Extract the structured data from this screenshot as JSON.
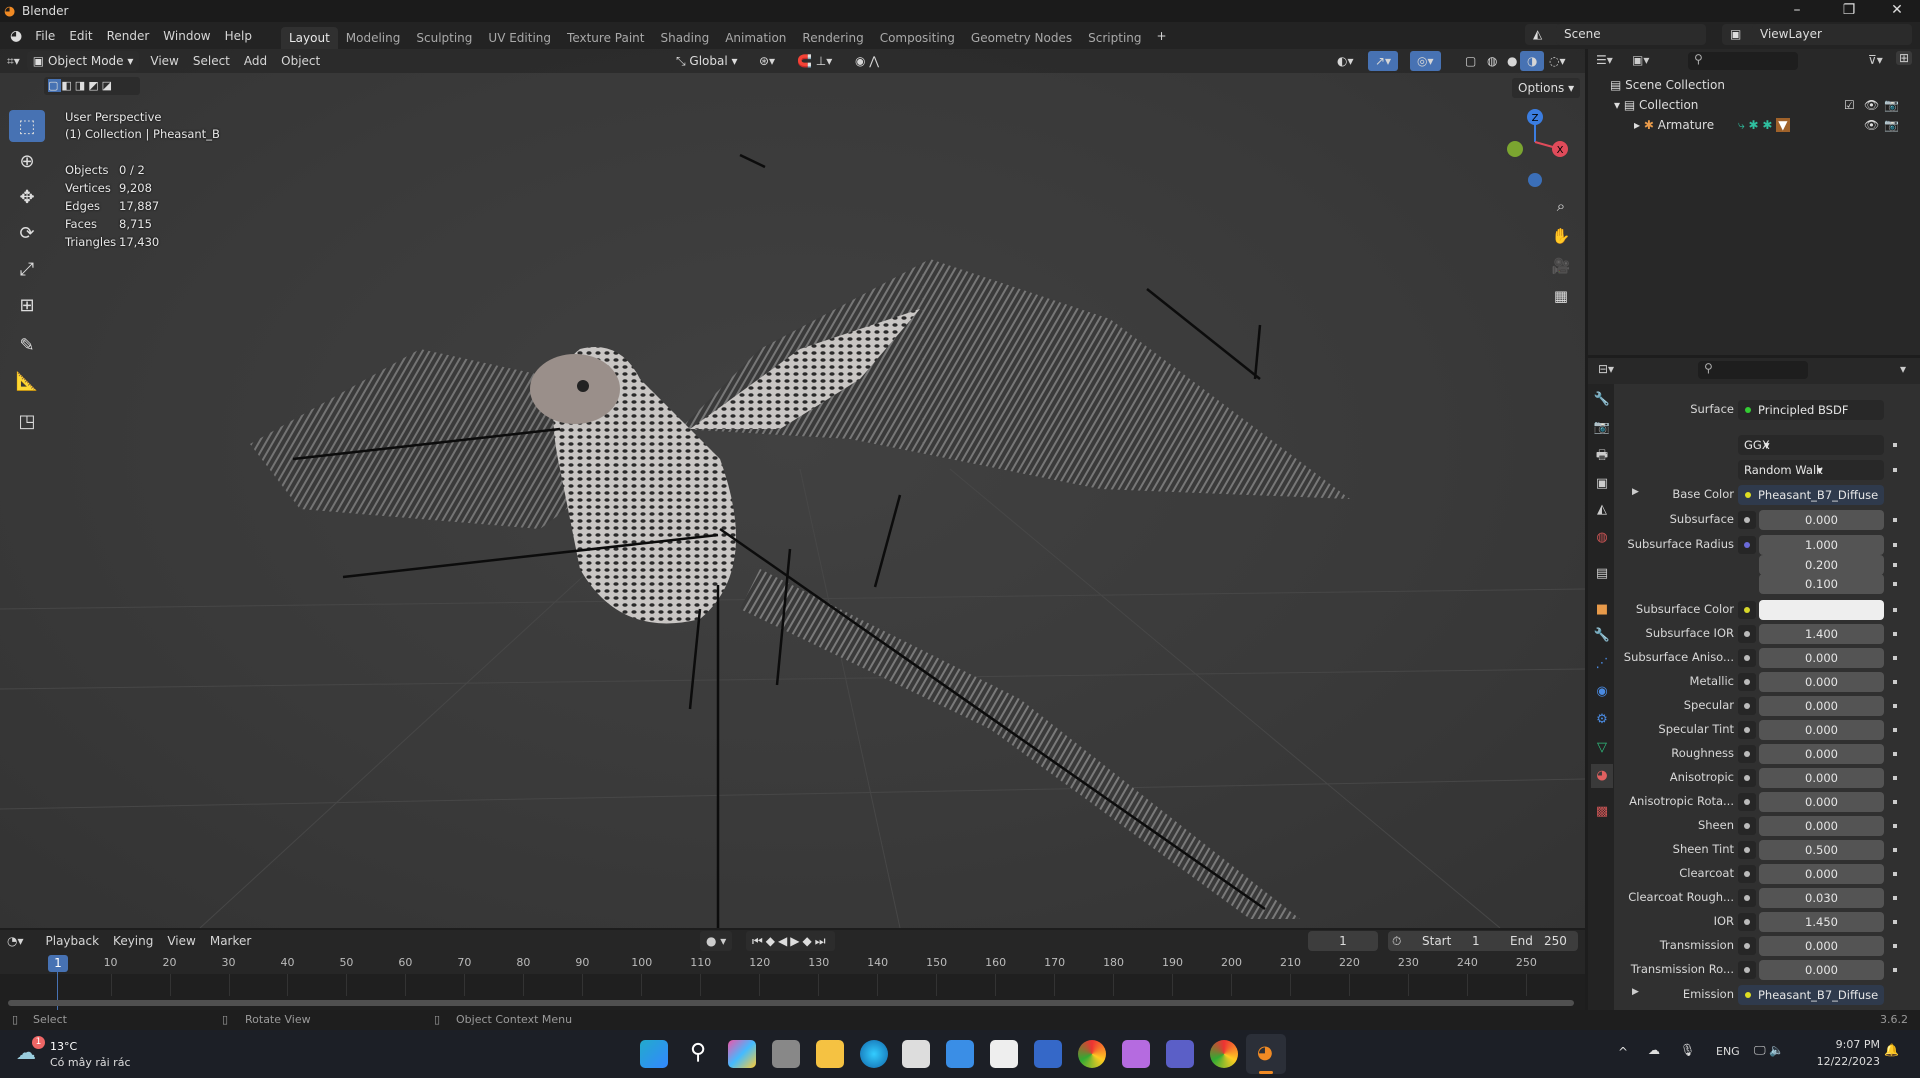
{
  "app": {
    "title": "Blender",
    "version": "3.6.2"
  },
  "menu": [
    "File",
    "Edit",
    "Render",
    "Window",
    "Help"
  ],
  "workspaces": [
    {
      "label": "Layout",
      "active": true
    },
    {
      "label": "Modeling"
    },
    {
      "label": "Sculpting"
    },
    {
      "label": "UV Editing"
    },
    {
      "label": "Texture Paint"
    },
    {
      "label": "Shading"
    },
    {
      "label": "Animation"
    },
    {
      "label": "Rendering"
    },
    {
      "label": "Compositing"
    },
    {
      "label": "Geometry Nodes"
    },
    {
      "label": "Scripting"
    }
  ],
  "add_workspace": "+",
  "scene": {
    "name": "Scene",
    "view_layer": "ViewLayer"
  },
  "viewport": {
    "mode": "Object Mode",
    "menus": [
      "View",
      "Select",
      "Add",
      "Object"
    ],
    "orientation": "Global",
    "options": "Options",
    "overlay_title": "User Perspective",
    "overlay_sub": "(1) Collection | Pheasant_B",
    "stats": [
      {
        "k": "Objects",
        "v": "0 / 2"
      },
      {
        "k": "Vertices",
        "v": "9,208"
      },
      {
        "k": "Edges",
        "v": "17,887"
      },
      {
        "k": "Faces",
        "v": "8,715"
      },
      {
        "k": "Triangles",
        "v": "17,430"
      }
    ],
    "gizmo": {
      "z": "Z",
      "x": "X"
    }
  },
  "outliner": {
    "items": [
      {
        "label": "Scene Collection"
      },
      {
        "label": "Collection"
      },
      {
        "label": "Armature"
      }
    ]
  },
  "properties": {
    "surface_label": "Surface",
    "surface_value": "Principled BSDF",
    "distribution": "GGX",
    "subsurface_method": "Random Walk",
    "base_color_label": "Base Color",
    "base_color_value": "Pheasant_B7_Diffuse",
    "rows": [
      {
        "label": "Subsurface",
        "value": "0.000",
        "fill": 0
      },
      {
        "label": "Subsurface Radius",
        "value": "1.000",
        "fill": 0,
        "sock": "#6a6ad8"
      },
      {
        "label": "",
        "value": "0.200",
        "fill": 0,
        "nosock": true
      },
      {
        "label": "",
        "value": "0.100",
        "fill": 0,
        "nosock": true
      },
      {
        "label": "Subsurface Color",
        "value": "",
        "fill": 0,
        "sock": "#d8d82a",
        "white": true
      },
      {
        "label": "Subsurface IOR",
        "value": "1.400",
        "fill": 0.1
      },
      {
        "label": "Subsurface Aniso...",
        "value": "0.000",
        "fill": 0
      },
      {
        "label": "Metallic",
        "value": "0.000",
        "fill": 0
      },
      {
        "label": "Specular",
        "value": "0.000",
        "fill": 0
      },
      {
        "label": "Specular Tint",
        "value": "0.000",
        "fill": 0
      },
      {
        "label": "Roughness",
        "value": "0.000",
        "fill": 0
      },
      {
        "label": "Anisotropic",
        "value": "0.000",
        "fill": 0
      },
      {
        "label": "Anisotropic Rota...",
        "value": "0.000",
        "fill": 0
      },
      {
        "label": "Sheen",
        "value": "0.000",
        "fill": 0
      },
      {
        "label": "Sheen Tint",
        "value": "0.500",
        "fill": 0.5
      },
      {
        "label": "Clearcoat",
        "value": "0.000",
        "fill": 0
      },
      {
        "label": "Clearcoat Rough...",
        "value": "0.030",
        "fill": 0.03
      },
      {
        "label": "IOR",
        "value": "1.450",
        "fill": 0
      },
      {
        "label": "Transmission",
        "value": "0.000",
        "fill": 0
      },
      {
        "label": "Transmission Ro...",
        "value": "0.000",
        "fill": 0
      }
    ],
    "emission_label": "Emission",
    "emission_value": "Pheasant_B7_Diffuse"
  },
  "timeline": {
    "menus": [
      "Playback",
      "Keying",
      "View",
      "Marker"
    ],
    "current_frame": "1",
    "start_label": "Start",
    "start": "1",
    "end_label": "End",
    "end": "250",
    "ticks": [
      "10",
      "20",
      "30",
      "40",
      "50",
      "60",
      "70",
      "80",
      "90",
      "100",
      "110",
      "120",
      "130",
      "140",
      "150",
      "160",
      "170",
      "180",
      "190",
      "200",
      "210",
      "220",
      "230",
      "240",
      "250"
    ]
  },
  "status": {
    "select": "Select",
    "rotate": "Rotate View",
    "context": "Object Context Menu"
  },
  "taskbar": {
    "temp": "13°C",
    "weather": "Có mây rải rác",
    "weather_badge": "1",
    "lang": "ENG",
    "time": "9:07 PM",
    "date": "12/22/2023"
  },
  "colors": {
    "accent": "#4772b3",
    "bg": "#303030"
  }
}
